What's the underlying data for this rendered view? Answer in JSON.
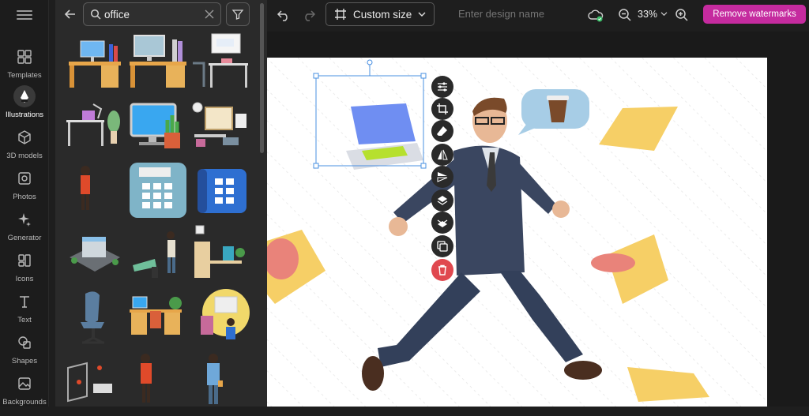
{
  "rail": {
    "items": [
      {
        "label": "Templates",
        "icon": "templates-icon"
      },
      {
        "label": "Illustrations",
        "icon": "illustrations-icon",
        "active": true
      },
      {
        "label": "3D models",
        "icon": "cube-icon"
      },
      {
        "label": "Photos",
        "icon": "photo-icon"
      },
      {
        "label": "Generator",
        "icon": "sparkle-icon"
      },
      {
        "label": "Icons",
        "icon": "icons-icon"
      },
      {
        "label": "Text",
        "icon": "text-icon"
      },
      {
        "label": "Shapes",
        "icon": "shapes-icon"
      },
      {
        "label": "Backgrounds",
        "icon": "backgrounds-icon"
      }
    ]
  },
  "search": {
    "value": "office",
    "placeholder": "Search"
  },
  "topbar": {
    "size_label": "Custom size",
    "design_name_placeholder": "Enter design name",
    "zoom": "33%",
    "remove_watermarks": "Remove watermarks"
  },
  "colors": {
    "accent": "#c52b9f",
    "selection": "#4a90e2",
    "delete": "#e0484f"
  }
}
